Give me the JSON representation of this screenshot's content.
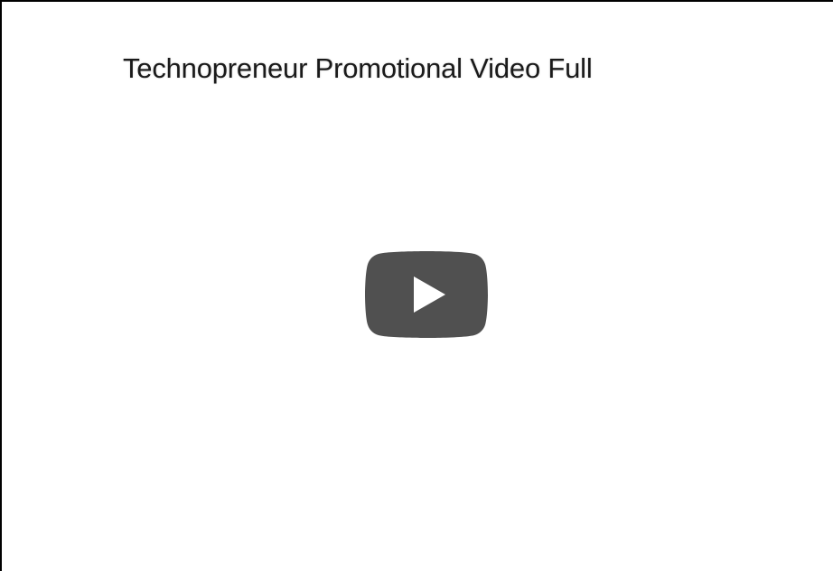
{
  "video": {
    "title": "Technopreneur Promotional Video Full"
  },
  "play_button": {
    "icon": "play-icon",
    "background_color": "#505050",
    "glyph_color": "#ffffff"
  },
  "colors": {
    "background": "#ffffff",
    "frame_border": "#000000",
    "title_text": "#1a1a1a"
  }
}
